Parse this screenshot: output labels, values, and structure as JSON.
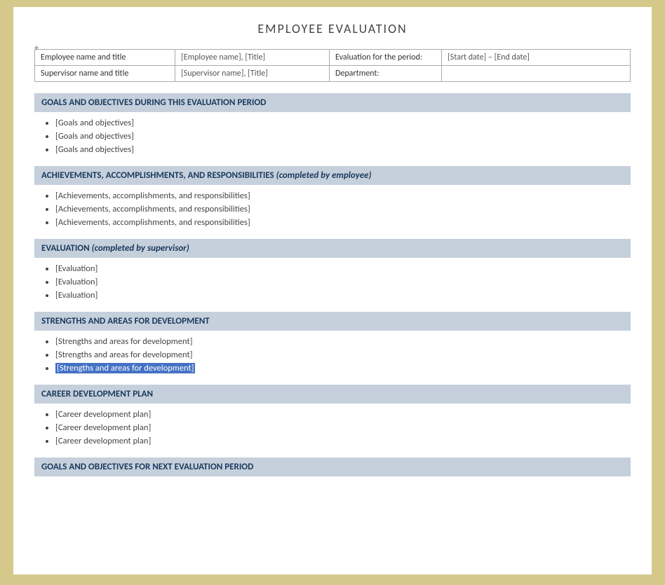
{
  "title": "EMPLOYEE EVALUATION",
  "plus_symbol": "+",
  "info_table": {
    "rows": [
      {
        "label1": "Employee name and title",
        "value1": "[Employee name], [Title]",
        "label2": "Evaluation for the period:",
        "value2": "[Start date] – [End date]"
      },
      {
        "label1": "Supervisor name and title",
        "value1": "[Supervisor name], [Title]",
        "label2": "Department:",
        "value2": ""
      }
    ]
  },
  "sections": [
    {
      "id": "goals",
      "header_text": "GOALS AND OBJECTIVES DURING THIS EVALUATION PERIOD",
      "header_italic": "",
      "items": [
        "[Goals and objectives]",
        "[Goals and objectives]",
        "[Goals and objectives]"
      ]
    },
    {
      "id": "achievements",
      "header_text": "ACHIEVEMENTS, ACCOMPLISHMENTS, AND RESPONSIBILITIES",
      "header_italic": "(completed by employee)",
      "items": [
        "[Achievements, accomplishments, and responsibilities]",
        "[Achievements, accomplishments, and responsibilities]",
        "[Achievements, accomplishments, and responsibilities]"
      ]
    },
    {
      "id": "evaluation",
      "header_text": "EVALUATION",
      "header_italic": "(completed by supervisor)",
      "items": [
        "[Evaluation]",
        "[Evaluation]",
        "[Evaluation]"
      ]
    },
    {
      "id": "strengths",
      "header_text": "STRENGTHS AND AREAS FOR DEVELOPMENT",
      "header_italic": "",
      "items": [
        "[Strengths and areas for development]",
        "[Strengths and areas for development]",
        "[Strengths and areas for development]"
      ],
      "highlighted_item": 2
    },
    {
      "id": "career",
      "header_text": "CAREER DEVELOPMENT PLAN",
      "header_italic": "",
      "items": [
        "[Career development plan]",
        "[Career development plan]",
        "[Career development plan]"
      ]
    },
    {
      "id": "goals-next",
      "header_text": "GOALS AND OBJECTIVES FOR NEXT EVALUATION PERIOD",
      "header_italic": "",
      "items": []
    }
  ]
}
